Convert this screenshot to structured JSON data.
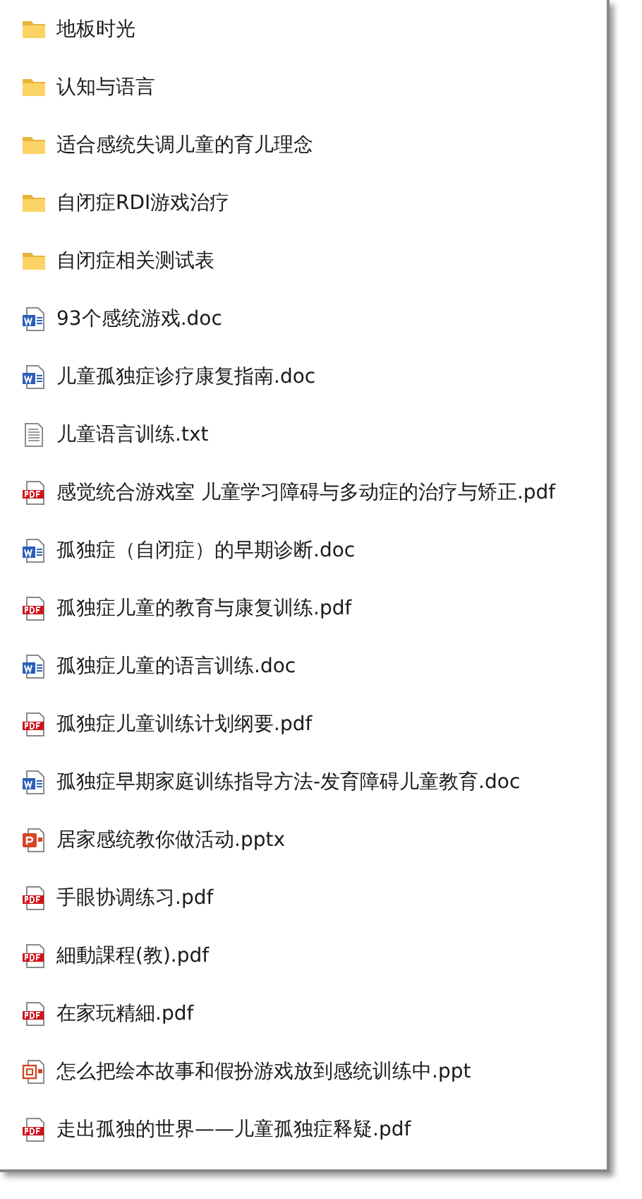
{
  "files": [
    {
      "kind": "folder",
      "name": "地板时光"
    },
    {
      "kind": "folder",
      "name": "认知与语言"
    },
    {
      "kind": "folder",
      "name": "适合感统失调儿童的育儿理念"
    },
    {
      "kind": "folder",
      "name": "自闭症RDI游戏治疗"
    },
    {
      "kind": "folder",
      "name": "自闭症相关测试表"
    },
    {
      "kind": "doc",
      "name": "93个感统游戏.doc"
    },
    {
      "kind": "doc",
      "name": "儿童孤独症诊疗康复指南.doc"
    },
    {
      "kind": "txt",
      "name": "儿童语言训练.txt"
    },
    {
      "kind": "pdf",
      "name": "感觉统合游戏室 儿童学习障碍与多动症的治疗与矫正.pdf"
    },
    {
      "kind": "doc",
      "name": "孤独症（自闭症）的早期诊断.doc"
    },
    {
      "kind": "pdf",
      "name": "孤独症儿童的教育与康复训练.pdf"
    },
    {
      "kind": "doc",
      "name": "孤独症儿童的语言训练.doc"
    },
    {
      "kind": "pdf",
      "name": "孤独症儿童训练计划纲要.pdf"
    },
    {
      "kind": "doc",
      "name": "孤独症早期家庭训练指导方法-发育障碍儿童教育.doc"
    },
    {
      "kind": "pptx",
      "name": "居家感统教你做活动.pptx"
    },
    {
      "kind": "pdf",
      "name": "手眼协调练习.pdf"
    },
    {
      "kind": "pdf",
      "name": "細動課程(教).pdf"
    },
    {
      "kind": "pdf",
      "name": "在家玩精細.pdf"
    },
    {
      "kind": "ppt",
      "name": "怎么把绘本故事和假扮游戏放到感统训练中.ppt"
    },
    {
      "kind": "pdf",
      "name": "走出孤独的世界——儿童孤独症释疑.pdf"
    }
  ]
}
